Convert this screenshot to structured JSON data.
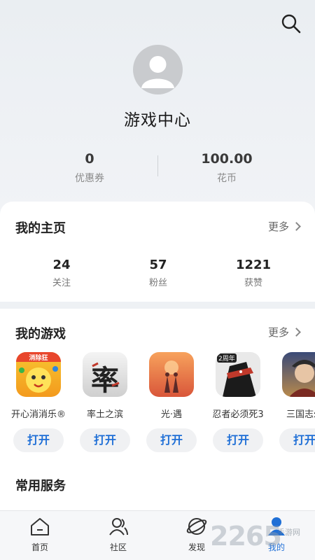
{
  "header": {
    "title": "游戏中心",
    "coupons_value": "0",
    "coupons_label": "优惠券",
    "coins_value": "100.00",
    "coins_label": "花币"
  },
  "home": {
    "title": "我的主页",
    "more": "更多",
    "stats": [
      {
        "value": "24",
        "label": "关注"
      },
      {
        "value": "57",
        "label": "粉丝"
      },
      {
        "value": "1221",
        "label": "获赞"
      }
    ]
  },
  "games": {
    "title": "我的游戏",
    "more": "更多",
    "items": [
      {
        "name": "开心消消乐®",
        "button": "打开",
        "icon": "happy-elimination-icon",
        "badge": "消除狂"
      },
      {
        "name": "率土之滨",
        "button": "打开",
        "icon": "shuaitu-icon",
        "badge": "率"
      },
      {
        "name": "光·遇",
        "button": "打开",
        "icon": "sky-icon"
      },
      {
        "name": "忍者必须死3",
        "button": "打开",
        "icon": "ninja-icon",
        "badge": "2周年"
      },
      {
        "name": "三国志幻",
        "button": "打开",
        "icon": "three-kingdoms-icon"
      }
    ]
  },
  "services": {
    "title": "常用服务"
  },
  "tabbar": {
    "items": [
      {
        "label": "首页",
        "icon": "home-icon"
      },
      {
        "label": "社区",
        "icon": "community-icon"
      },
      {
        "label": "发现",
        "icon": "discover-icon"
      },
      {
        "label": "我的",
        "icon": "profile-icon",
        "active": true
      }
    ]
  },
  "watermark": {
    "text": "2265",
    "sub": "手游网"
  },
  "colors": {
    "accent": "#1f6fd6",
    "background": "#eef1f4"
  }
}
